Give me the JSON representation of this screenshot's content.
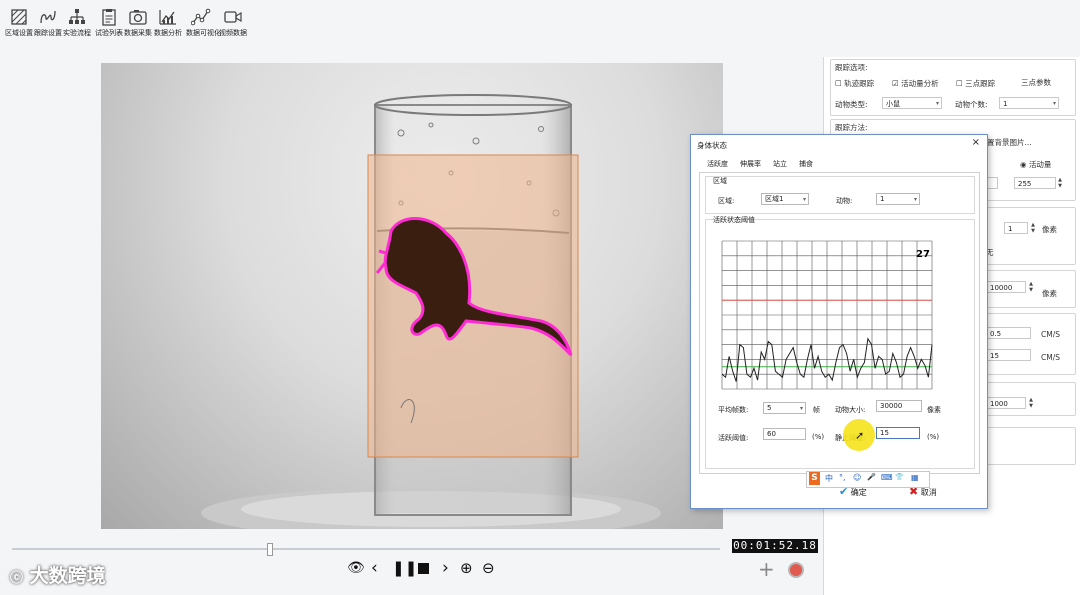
{
  "toolbar": {
    "items": [
      {
        "label": "区域设置",
        "icon": "region-icon"
      },
      {
        "label": "跟踪设置",
        "icon": "track-icon"
      },
      {
        "label": "实验流程",
        "icon": "flow-icon"
      },
      {
        "label": "试验列表",
        "icon": "list-icon"
      },
      {
        "label": "数据采集",
        "icon": "camera-icon"
      },
      {
        "label": "数据分析",
        "icon": "chart-icon"
      },
      {
        "label": "数据可视化",
        "icon": "visual-icon"
      },
      {
        "label": "视频数据",
        "icon": "video-icon"
      }
    ]
  },
  "right_panel": {
    "tracking_options_title": "跟踪选项:",
    "opt_trajectory": "轨迹跟踪",
    "opt_activity": "活动量分析",
    "opt_three_point": "三点跟踪",
    "three_point_params": "三点参数",
    "animal_type_label": "动物类型:",
    "animal_type_value": "小鼠",
    "animal_count_label": "动物个数:",
    "animal_count_value": "1",
    "tracking_method_title": "跟踪方法:",
    "bg_image_label": "置背景图片...",
    "activity_radio_label": "活动量",
    "val_255": "255",
    "val_1": "1",
    "unit_pixel_1": "像素",
    "suffix_char": "无",
    "val_10000a": "10000",
    "unit_pixel_2": "像素",
    "val_05": "0.5",
    "unit_cms_1": "CM/S",
    "val_15": "15",
    "unit_cms_2": "CM/S",
    "val_10000b": "1000"
  },
  "dialog": {
    "title": "身体状态",
    "close": "×",
    "tabs": [
      "活跃度",
      "伸展率",
      "站立",
      "捕食"
    ],
    "region_group_title": "区域",
    "region_label": "区域:",
    "region_value": "区域1",
    "animal_label": "动物:",
    "animal_value": "1",
    "threshold_group_title": "活跃状态阈值",
    "chart_number": "27",
    "avg_frames_label": "平均帧数:",
    "avg_frames_value": "5",
    "avg_frames_unit": "帧",
    "animal_size_label": "动物大小:",
    "animal_size_value": "30000",
    "animal_size_unit": "像素",
    "active_threshold_label": "活跃阈值:",
    "active_threshold_value": "60",
    "active_threshold_unit": "(%)",
    "static_threshold_label": "静止阈值:",
    "static_threshold_value": "15",
    "static_threshold_unit": "(%)",
    "ok_label": "确定",
    "cancel_label": "取消"
  },
  "ime_bar": {
    "items": [
      "S",
      "中",
      "°,",
      "☺",
      "🎤",
      "⌨",
      "👕",
      "▦"
    ]
  },
  "playback": {
    "timecode": "00:01:52.18",
    "buttons": [
      "eye-icon",
      "prev-icon",
      "pause-icon",
      "stop-icon",
      "next-icon",
      "zoom-in-icon",
      "zoom-out-icon"
    ],
    "add_symbol": "+",
    "progress_fraction": 0.36
  },
  "watermark": "大数跨境",
  "colors": {
    "activity_line": "#222222",
    "active_threshold_line": "#d9534f",
    "static_threshold_line": "#3cb043",
    "roi_fill": "#f0b48a",
    "mouse_outline": "#ff2ad4",
    "dialog_border": "#6b8fc9",
    "ok_check": "#2a8ad4",
    "cancel_x": "#d21f1f"
  },
  "chart_data": {
    "type": "line",
    "xlabel": "",
    "ylabel": "",
    "y_range": [
      0,
      100
    ],
    "active_threshold": 60,
    "static_threshold": 15,
    "series": [
      {
        "values": [
          10,
          8,
          22,
          12,
          5,
          30,
          28,
          10,
          8,
          14,
          6,
          25,
          20,
          32,
          30,
          12,
          10,
          8,
          20,
          24,
          28,
          18,
          10,
          8,
          20,
          30,
          14,
          22,
          12,
          8,
          10,
          6,
          18,
          28,
          30,
          24,
          12,
          20,
          8,
          14,
          18,
          34,
          30,
          14,
          22,
          20,
          10,
          12,
          24,
          18,
          8,
          10,
          22,
          28,
          22,
          14,
          20,
          16,
          8,
          30
        ]
      }
    ]
  }
}
